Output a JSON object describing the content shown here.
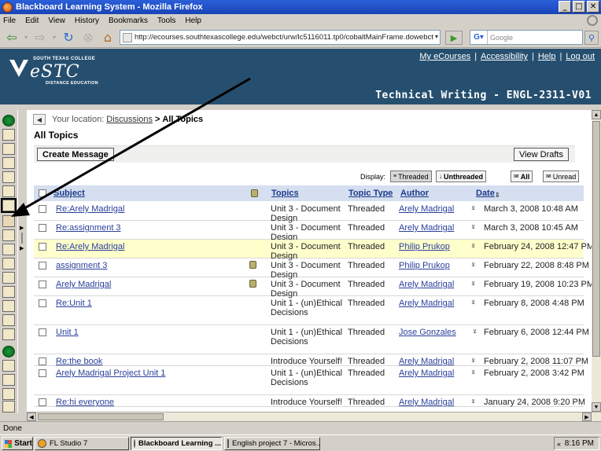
{
  "window": {
    "title": "Blackboard Learning System - Mozilla Firefox",
    "buttons": [
      "_",
      "□",
      "✕"
    ]
  },
  "menu": [
    "File",
    "Edit",
    "View",
    "History",
    "Bookmarks",
    "Tools",
    "Help"
  ],
  "nav": {
    "url": "http://ecourses.southtexascollege.edu/webct/urw/lc5116011.tp0/cobaltMainFrame.dowebct",
    "search_placeholder": "Google"
  },
  "banner": {
    "school": "SOUTH TEXAS COLLEGE",
    "logo": "eSTC",
    "distance": "DISTANCE EDUCATION",
    "links": [
      "My eCourses",
      "Accessibility",
      "Help",
      "Log out"
    ],
    "course_title": "Technical Writing - ENGL-2311-V01"
  },
  "breadcrumb": {
    "prefix": "Your location:",
    "parent": "Discussions",
    "separator": ">",
    "current": "All Topics"
  },
  "page_title": "All Topics",
  "actions": {
    "create": "Create Message",
    "drafts": "View Drafts"
  },
  "display": {
    "label": "Display:",
    "threaded": "Threaded",
    "unthreaded": "Unthreaded",
    "all": "All",
    "unread": "Unread"
  },
  "columns": {
    "subject": "Subject",
    "topics": "Topics",
    "topic_type": "Topic Type",
    "author": "Author",
    "date": "Date"
  },
  "rows": [
    {
      "subject": "Re:Arely Madrigal",
      "topics": "Unit 3 - Document Design",
      "type": "Threaded",
      "author": "Arely Madrigal",
      "date": "March 3, 2008 10:48 AM"
    },
    {
      "subject": "Re:assignment 3",
      "topics": "Unit 3 - Document Design",
      "type": "Threaded",
      "author": "Arely Madrigal",
      "date": "March 3, 2008 10:45 AM"
    },
    {
      "subject": "Re:Arely Madrigal",
      "topics": "Unit 3 - Document Design",
      "type": "Threaded",
      "author": "Philip Prukop",
      "date": "February 24, 2008 12:47 PM"
    },
    {
      "subject": "assignment 3",
      "topics": "Unit 3 - Document Design",
      "type": "Threaded",
      "author": "Philip Prukop",
      "date": "February 22, 2008 8:48 PM"
    },
    {
      "subject": "Arely Madrigal",
      "topics": "Unit 3 - Document Design",
      "type": "Threaded",
      "author": "Arely Madrigal",
      "date": "February 19, 2008 10:23 PM"
    },
    {
      "subject": "Re:Unit 1",
      "topics": "Unit 1 - (un)Ethical Decisions",
      "type": "Threaded",
      "author": "Arely Madrigal",
      "date": "February 8, 2008 4:48 PM"
    },
    {
      "subject": "Unit 1",
      "topics": "Unit 1 - (un)Ethical Decisions",
      "type": "Threaded",
      "author": "Jose Gonzales",
      "date": "February 6, 2008 12:44 PM"
    },
    {
      "subject": "Re:the book",
      "topics": "Introduce Yourself!",
      "type": "Threaded",
      "author": "Arely Madrigal",
      "date": "February 2, 2008 11:07 PM"
    },
    {
      "subject": "Arely Madrigal Project Unit 1",
      "topics": "Unit 1 - (un)Ethical Decisions",
      "type": "Threaded",
      "author": "Arely Madrigal",
      "date": "February 2, 2008 3:42 PM"
    },
    {
      "subject": "Re:hi everyone",
      "topics": "Introduce Yourself!",
      "type": "Threaded",
      "author": "Arely Madrigal",
      "date": "January 24, 2008 9:20 PM"
    }
  ],
  "status": "Done",
  "taskbar": {
    "start": "Start",
    "items": [
      "FL Studio 7",
      "Blackboard Learning ...",
      "English project 7 - Micros..."
    ],
    "clock": "8:16 PM",
    "tray_chevron": "«"
  }
}
